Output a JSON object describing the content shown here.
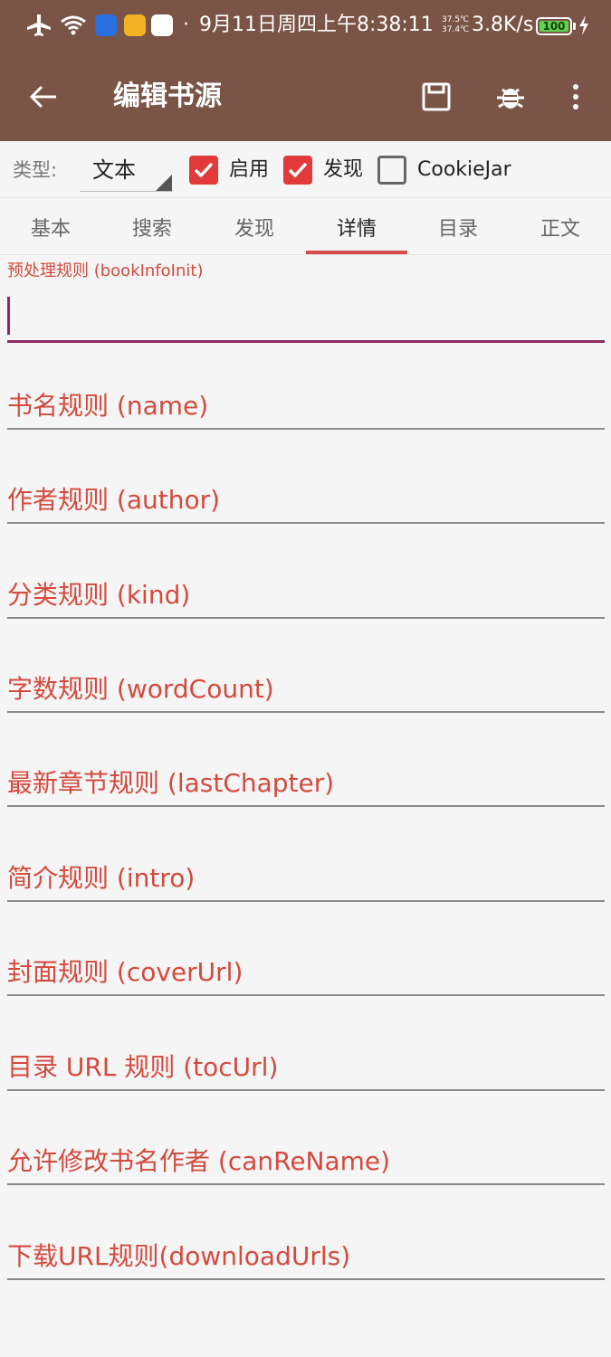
{
  "status_bar": {
    "datetime": "9月11日周四上午8:38:11",
    "temp_high": "37.5℃",
    "temp_low": "37.4℃",
    "net_speed": "3.8K/s",
    "battery": "100",
    "battery_level": 1.0,
    "dot": "·"
  },
  "toolbar": {
    "title": "编辑书源"
  },
  "options": {
    "type_label": "类型:",
    "type_value": "文本",
    "enable_label": "启用",
    "enable_checked": true,
    "discover_label": "发现",
    "discover_checked": true,
    "cookiejar_label": "CookieJar",
    "cookiejar_checked": false
  },
  "tabs": [
    {
      "label": "基本"
    },
    {
      "label": "搜索"
    },
    {
      "label": "发现"
    },
    {
      "label": "详情",
      "active": true
    },
    {
      "label": "目录"
    },
    {
      "label": "正文"
    }
  ],
  "fields": {
    "focused": {
      "label": "预处理规则 (bookInfoInit)",
      "value": ""
    },
    "items": [
      {
        "label": "书名规则 (name)"
      },
      {
        "label": "作者规则 (author)"
      },
      {
        "label": "分类规则 (kind)"
      },
      {
        "label": "字数规则 (wordCount)"
      },
      {
        "label": "最新章节规则 (lastChapter)"
      },
      {
        "label": "简介规则 (intro)"
      },
      {
        "label": "封面规则 (coverUrl)"
      },
      {
        "label": "目录 URL 规则 (tocUrl)"
      },
      {
        "label": "允许修改书名作者 (canReName)"
      },
      {
        "label": "下载URL规则(downloadUrls)"
      }
    ]
  },
  "colors": {
    "primary": "#7a5446",
    "accent": "#d44a3e",
    "checkbox": "#e23a3a",
    "focus": "#8e2a5e"
  }
}
